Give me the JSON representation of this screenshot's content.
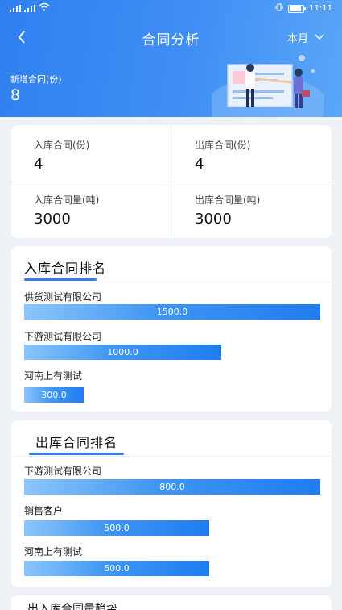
{
  "status_bar": {
    "time": "11:11"
  },
  "header": {
    "title": "合同分析",
    "period": "本月",
    "new_contracts_label": "新增合同(份)",
    "new_contracts_value": "8"
  },
  "stats": [
    {
      "label": "入库合同(份)",
      "value": "4"
    },
    {
      "label": "出库合同(份)",
      "value": "4"
    },
    {
      "label": "入库合同量(吨)",
      "value": "3000"
    },
    {
      "label": "出库合同量(吨)",
      "value": "3000"
    }
  ],
  "inbound_ranking": {
    "title": "入库合同排名",
    "items": [
      {
        "name": "供货测试有限公司",
        "value": "1500.0",
        "amount": 1500
      },
      {
        "name": "下游测试有限公司",
        "value": "1000.0",
        "amount": 1000
      },
      {
        "name": "河南上有测试",
        "value": "300.0",
        "amount": 300
      }
    ]
  },
  "outbound_ranking": {
    "title": "出库合同排名",
    "items": [
      {
        "name": "下游测试有限公司",
        "value": "800.0",
        "amount": 800
      },
      {
        "name": "销售客户",
        "value": "500.0",
        "amount": 500
      },
      {
        "name": "河南上有测试",
        "value": "500.0",
        "amount": 500
      }
    ]
  },
  "next_section": {
    "title": "出入库合同量趋势"
  },
  "colors": {
    "header": "#2f7ff0",
    "bar": "#1f7df0",
    "background": "#eef1f6"
  }
}
